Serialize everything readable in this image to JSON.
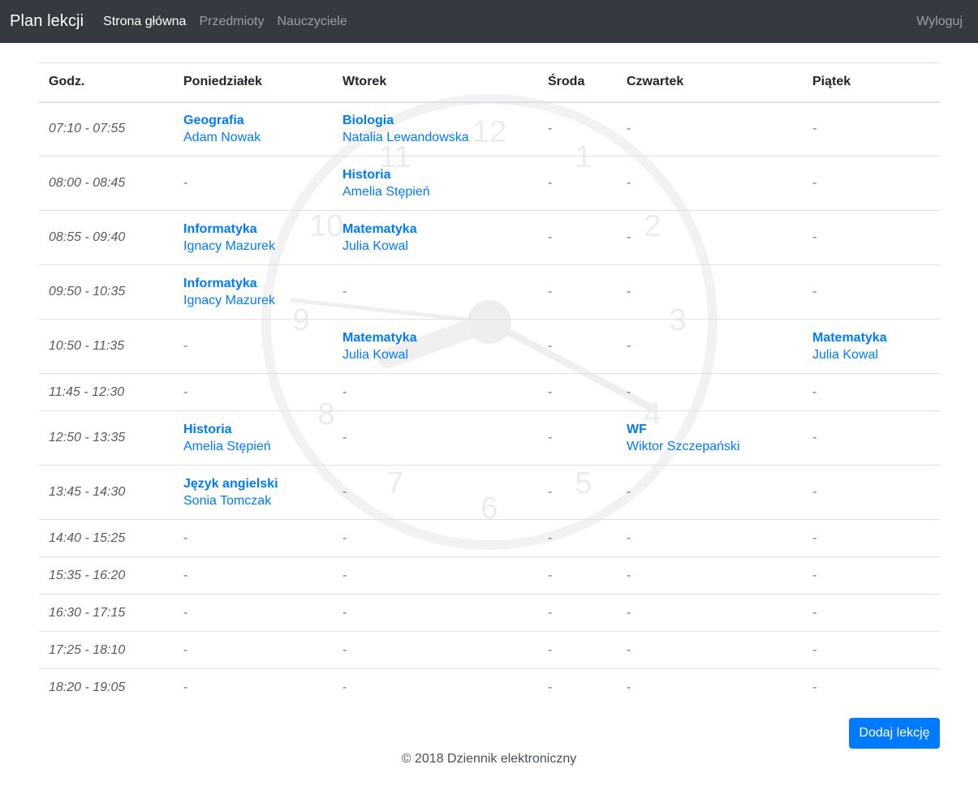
{
  "navbar": {
    "brand": "Plan lekcji",
    "links": [
      "Strona główna",
      "Przedmioty",
      "Nauczyciele"
    ],
    "logout": "Wyloguj"
  },
  "clock": {
    "numbers": [
      "12",
      "1",
      "2",
      "3",
      "4",
      "5",
      "6",
      "7",
      "8",
      "9",
      "10",
      "11"
    ]
  },
  "table": {
    "headers": [
      "Godz.",
      "Poniedziałek",
      "Wtorek",
      "Środa",
      "Czwartek",
      "Piątek"
    ],
    "rows": [
      {
        "time": "07:10 - 07:55",
        "cells": [
          {
            "subject": "Geografia",
            "teacher": "Adam Nowak"
          },
          {
            "subject": "Biologia",
            "teacher": "Natalia Lewandowska"
          },
          {
            "empty": "-"
          },
          {
            "empty": "-"
          },
          {
            "empty": "-"
          }
        ]
      },
      {
        "time": "08:00 - 08:45",
        "cells": [
          {
            "empty": "-"
          },
          {
            "subject": "Historia",
            "teacher": "Amelia Stępień"
          },
          {
            "empty": "-"
          },
          {
            "empty": "-"
          },
          {
            "empty": "-"
          }
        ]
      },
      {
        "time": "08:55 - 09:40",
        "cells": [
          {
            "subject": "Informatyka",
            "teacher": "Ignacy Mazurek"
          },
          {
            "subject": "Matematyka",
            "teacher": "Julia Kowal"
          },
          {
            "empty": "-"
          },
          {
            "empty": "-"
          },
          {
            "empty": "-"
          }
        ]
      },
      {
        "time": "09:50 - 10:35",
        "cells": [
          {
            "subject": "Informatyka",
            "teacher": "Ignacy Mazurek"
          },
          {
            "empty": "-"
          },
          {
            "empty": "-"
          },
          {
            "empty": "-"
          },
          {
            "empty": "-"
          }
        ]
      },
      {
        "time": "10:50 - 11:35",
        "cells": [
          {
            "empty": "-"
          },
          {
            "subject": "Matematyka",
            "teacher": "Julia Kowal"
          },
          {
            "empty": "-"
          },
          {
            "empty": "-"
          },
          {
            "subject": "Matematyka",
            "teacher": "Julia Kowal"
          }
        ]
      },
      {
        "time": "11:45 - 12:30",
        "cells": [
          {
            "empty": "-"
          },
          {
            "empty": "-"
          },
          {
            "empty": "-"
          },
          {
            "empty": "-"
          },
          {
            "empty": "-"
          }
        ]
      },
      {
        "time": "12:50 - 13:35",
        "cells": [
          {
            "subject": "Historia",
            "teacher": "Amelia Stępień"
          },
          {
            "empty": "-"
          },
          {
            "empty": "-"
          },
          {
            "subject": "WF",
            "teacher": "Wiktor Szczepański"
          },
          {
            "empty": "-"
          }
        ]
      },
      {
        "time": "13:45 - 14:30",
        "cells": [
          {
            "subject": "Język angielski",
            "teacher": "Sonia Tomczak"
          },
          {
            "empty": "-"
          },
          {
            "empty": "-"
          },
          {
            "empty": "-"
          },
          {
            "empty": "-"
          }
        ]
      },
      {
        "time": "14:40 - 15:25",
        "cells": [
          {
            "empty": "-"
          },
          {
            "empty": "-"
          },
          {
            "empty": "-"
          },
          {
            "empty": "-"
          },
          {
            "empty": "-"
          }
        ]
      },
      {
        "time": "15:35 - 16:20",
        "cells": [
          {
            "empty": "-"
          },
          {
            "empty": "-"
          },
          {
            "empty": "-"
          },
          {
            "empty": "-"
          },
          {
            "empty": "-"
          }
        ]
      },
      {
        "time": "16:30 - 17:15",
        "cells": [
          {
            "empty": "-"
          },
          {
            "empty": "-"
          },
          {
            "empty": "-"
          },
          {
            "empty": "-"
          },
          {
            "empty": "-"
          }
        ]
      },
      {
        "time": "17:25 - 18:10",
        "cells": [
          {
            "empty": "-"
          },
          {
            "empty": "-"
          },
          {
            "empty": "-"
          },
          {
            "empty": "-"
          },
          {
            "empty": "-"
          }
        ]
      },
      {
        "time": "18:20 - 19:05",
        "cells": [
          {
            "empty": "-"
          },
          {
            "empty": "-"
          },
          {
            "empty": "-"
          },
          {
            "empty": "-"
          },
          {
            "empty": "-"
          }
        ]
      }
    ]
  },
  "add_button": "Dodaj lekcję",
  "footer": "© 2018 Dziennik elektroniczny",
  "colors": {
    "navbar_bg": "#343a40",
    "link": "#007bff",
    "button_bg": "#007bff"
  }
}
